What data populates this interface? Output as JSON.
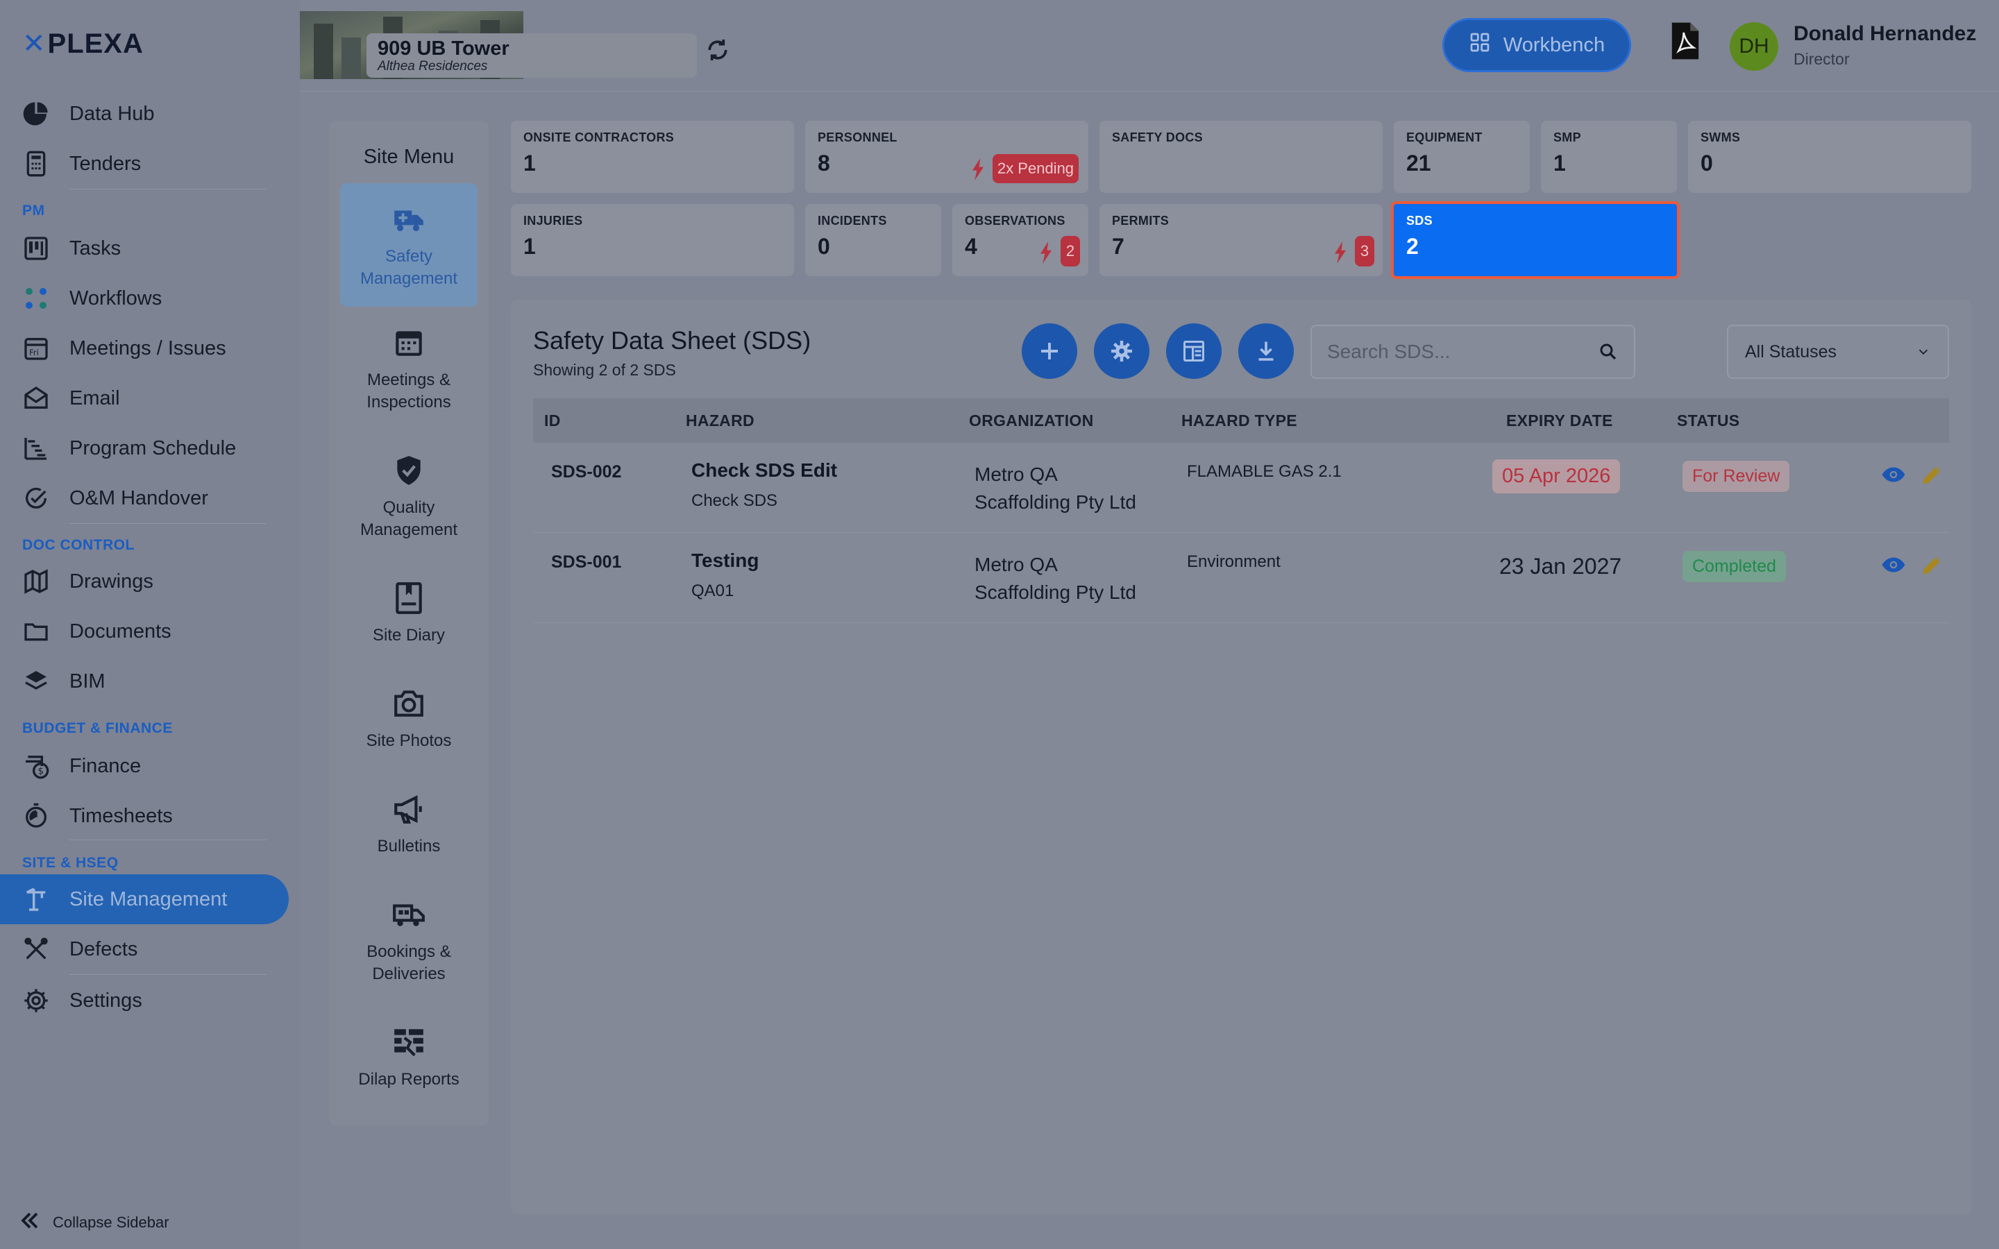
{
  "app": {
    "logo": "PLEXA",
    "logo_mark": "✕"
  },
  "sidebar": {
    "items_top": [
      {
        "label": "Data Hub",
        "icon": "pie-chart-icon"
      },
      {
        "label": "Tenders",
        "icon": "calculator-icon"
      }
    ],
    "sections": [
      {
        "title": "PM",
        "items": [
          {
            "label": "Tasks",
            "icon": "kanban-icon"
          },
          {
            "label": "Workflows",
            "icon": "workflow-icon"
          },
          {
            "label": "Meetings / Issues",
            "icon": "calendar-fri-icon"
          },
          {
            "label": "Email",
            "icon": "envelope-icon"
          },
          {
            "label": "Program Schedule",
            "icon": "gantt-icon"
          },
          {
            "label": "O&M Handover",
            "icon": "check-circle-icon"
          }
        ]
      },
      {
        "title": "DOC CONTROL",
        "items": [
          {
            "label": "Drawings",
            "icon": "map-icon"
          },
          {
            "label": "Documents",
            "icon": "folder-icon"
          },
          {
            "label": "BIM",
            "icon": "layers-icon"
          }
        ]
      },
      {
        "title": "BUDGET & FINANCE",
        "items": [
          {
            "label": "Finance",
            "icon": "dollar-icon"
          },
          {
            "label": "Timesheets",
            "icon": "stopwatch-icon"
          }
        ]
      },
      {
        "title": "SITE & HSEQ",
        "items": [
          {
            "label": "Site Management",
            "icon": "crane-icon"
          },
          {
            "label": "Defects",
            "icon": "tools-icon"
          },
          {
            "label": "Settings",
            "icon": "gear-icon"
          }
        ]
      }
    ],
    "collapse_label": "Collapse Sidebar"
  },
  "topbar": {
    "project_name": "909 UB Tower",
    "project_sub": "Althea Residences",
    "workbench_label": "Workbench",
    "user_initials": "DH",
    "user_name": "Donald Hernandez",
    "user_role": "Director"
  },
  "site_menu": {
    "title": "Site Menu",
    "items": [
      {
        "label": "Safety Management",
        "icon": "ambulance-icon"
      },
      {
        "label": "Meetings & Inspections",
        "icon": "calendar-icon"
      },
      {
        "label": "Quality Management",
        "icon": "shield-check-icon"
      },
      {
        "label": "Site Diary",
        "icon": "diary-icon"
      },
      {
        "label": "Site Photos",
        "icon": "camera-icon"
      },
      {
        "label": "Bulletins",
        "icon": "megaphone-icon"
      },
      {
        "label": "Bookings & Deliveries",
        "icon": "truck-icon"
      },
      {
        "label": "Dilap Reports",
        "icon": "broken-wall-icon"
      }
    ]
  },
  "stats": {
    "onsite": {
      "label": "ONSITE CONTRACTORS",
      "value": "1"
    },
    "personnel": {
      "label": "PERSONNEL",
      "value": "8",
      "pill": "2x Pending"
    },
    "safety_docs": {
      "label": "SAFETY DOCS",
      "value": ""
    },
    "equipment": {
      "label": "EQUIPMENT",
      "value": "21"
    },
    "smp": {
      "label": "SMP",
      "value": "1"
    },
    "swms": {
      "label": "SWMS",
      "value": "0"
    },
    "injuries": {
      "label": "INJURIES",
      "value": "1"
    },
    "incidents": {
      "label": "INCIDENTS",
      "value": "0"
    },
    "observations": {
      "label": "OBSERVATIONS",
      "value": "4",
      "pill": "2"
    },
    "permits": {
      "label": "PERMITS",
      "value": "7",
      "pill": "3"
    },
    "sds": {
      "label": "SDS",
      "value": "2"
    }
  },
  "colors": {
    "accent": "#0a6cf0",
    "selected_border": "#ea5b3c",
    "danger": "#b8323f",
    "success": "#1f8a4c"
  },
  "sds": {
    "title": "Safety Data Sheet (SDS)",
    "subtitle": "Showing 2 of 2 SDS",
    "search_placeholder": "Search SDS...",
    "status_filter": "All Statuses",
    "columns": [
      "ID",
      "HAZARD",
      "ORGANIZATION",
      "HAZARD TYPE",
      "EXPIRY DATE",
      "STATUS"
    ],
    "rows": [
      {
        "id": "SDS-002",
        "hazard": "Check SDS Edit",
        "hazard_sub": "Check SDS",
        "org1": "Metro QA",
        "org2": "Scaffolding Pty Ltd",
        "type": "FLAMABLE GAS 2.1",
        "expiry": "05 Apr 2026",
        "status": "For Review"
      },
      {
        "id": "SDS-001",
        "hazard": "Testing",
        "hazard_sub": "QA01",
        "org1": "Metro QA",
        "org2": "Scaffolding Pty Ltd",
        "type": "Environment",
        "expiry": "23 Jan 2027",
        "status": "Completed"
      }
    ]
  }
}
